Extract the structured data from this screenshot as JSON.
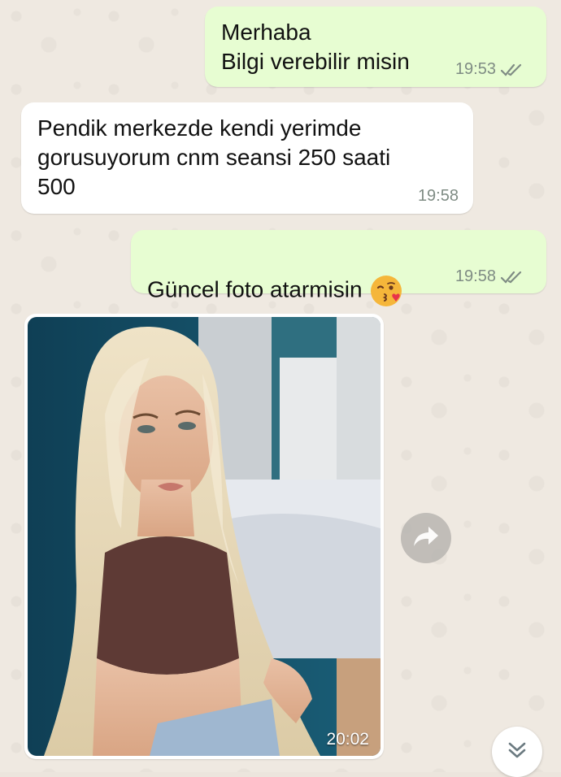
{
  "messages": [
    {
      "direction": "out",
      "lines": "Merhaba\nBilgi verebilir misin",
      "time": "19:53",
      "status": "read"
    },
    {
      "direction": "in",
      "lines": "Pendik merkezde kendi yerimde\ngorusuyorum cnm seansi 250 saati\n500",
      "time": "19:58"
    },
    {
      "direction": "out",
      "lines": "Güncel foto atarmisin",
      "emoji": "kissing-wink-emoji",
      "time": "19:58",
      "status": "read"
    }
  ],
  "photo_message": {
    "time": "20:02"
  },
  "icons": {
    "read_ticks": "double-check-icon",
    "forward": "forward-arrow-icon",
    "scroll_down": "double-chevron-down-icon"
  },
  "colors": {
    "outgoing_bubble": "#e7fdd2",
    "incoming_bubble": "#ffffff",
    "tick": "#7f8c84",
    "chat_background": "#efe9e1"
  }
}
